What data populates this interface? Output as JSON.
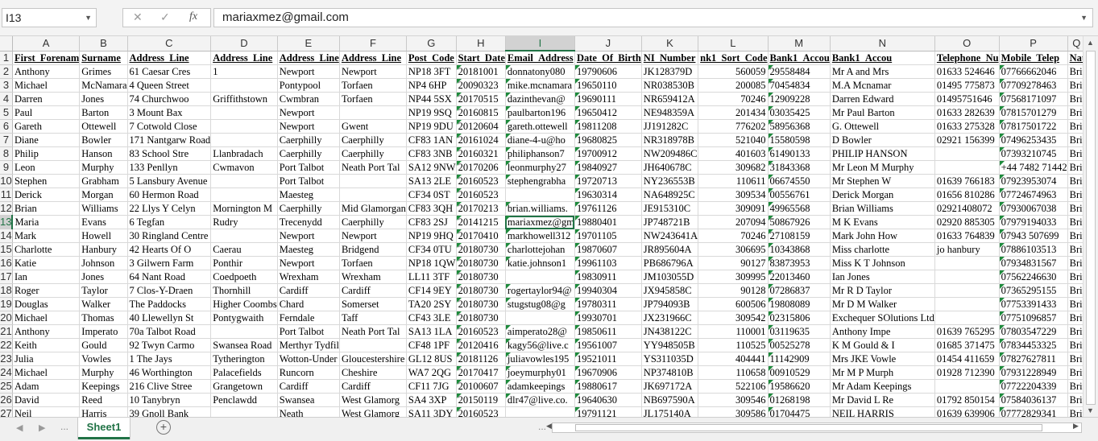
{
  "formula_bar": {
    "name_box": "I13",
    "cancel_icon": "✕",
    "confirm_icon": "✓",
    "fx_label": "fx",
    "value": "mariaxmez@gmail.com"
  },
  "columns": [
    "A",
    "B",
    "C",
    "D",
    "E",
    "F",
    "G",
    "H",
    "I",
    "J",
    "K",
    "L",
    "M",
    "N",
    "O",
    "P",
    "Q"
  ],
  "selected_column": "I",
  "selected_row": 13,
  "header_row": [
    "First_Forenam",
    "Surname",
    "Address_Line",
    "Address_Line",
    "Address_Line",
    "Address_Line",
    "Post_Code",
    "Start_Date",
    "Email_Address",
    "Date_Of_Birth",
    "NI_Number",
    "nk1_Sort_Code",
    "Bank1_Accou",
    "Bank1_Accou",
    "Telephone_Nu",
    "Mobile_Telep",
    "Nat"
  ],
  "rows": [
    [
      "Anthony",
      "Grimes",
      "61 Caesar Cres",
      "1",
      "Newport",
      "Newport",
      "NP18 3FT",
      "20181001",
      "donnatony080",
      "19790606",
      "JK128379D",
      "560059",
      "29558484",
      "Mr A and Mrs",
      "01633 524646",
      "07766662046",
      "Brit"
    ],
    [
      "Michael",
      "McNamara",
      "4 Queen Street",
      "",
      "Pontypool",
      "Torfaen",
      "NP4 6HP",
      "20090323",
      "mike.mcnamara",
      "19650110",
      "NR038530B",
      "200085",
      "70454834",
      "M.A Mcnamar",
      "01495 775873",
      "07709278463",
      "Brit"
    ],
    [
      "Darren",
      "Jones",
      "74 Churchwoo",
      "Griffithstown",
      "Cwmbran",
      "Torfaen",
      "NP44 5SX",
      "20170515",
      "dazinthevan@",
      "19690111",
      "NR659412A",
      "70246",
      "12909228",
      "Darren Edward",
      "01495751646",
      "07568171097",
      "Brit"
    ],
    [
      "Paul",
      "Barton",
      "3 Mount Bax",
      "",
      "Newport",
      "",
      "NP19 9SQ",
      "20160815",
      "paulbarton196",
      "19650412",
      "NE948359A",
      "201434",
      "03035425",
      "Mr Paul Barton",
      "01633 282639",
      "07815701279",
      "Brit"
    ],
    [
      "Gareth",
      "Ottewell",
      "7 Cotwold Close",
      "",
      "Newport",
      "Gwent",
      "NP19 9DU",
      "20120604",
      "gareth.ottewell",
      "19811208",
      "JJ191282C",
      "776202",
      "58956368",
      "G. Ottewell",
      "01633 275328",
      "07817501722",
      "Brit"
    ],
    [
      "Diane",
      "Bowler",
      "171 Nantgarw Road",
      "",
      "Caerphilly",
      "Caerphilly",
      "CF83 1AN",
      "20161024",
      "diane-4-u@ho",
      "19680825",
      "NR318978B",
      "521040",
      "15580598",
      "D Bowler",
      "02921 156399",
      "07496253435",
      "Brit"
    ],
    [
      "Philip",
      "Hanson",
      "83 School Stre",
      "Llanbradach",
      "Caerphilly",
      "Caerphilly",
      "CF83 3NB",
      "20160321",
      "philiphanson7",
      "19700912",
      "NW209486C",
      "401603",
      "61490133",
      "PHILIP HANSON",
      "",
      "07393210745",
      "Brit"
    ],
    [
      "Leon",
      "Murphy",
      "133 Penllyn",
      "Cwmavon",
      "Port Talbot",
      "Neath Port Tal",
      "SA12 9NW",
      "20170206",
      "leonmurphy27",
      "19840927",
      "JH640678C",
      "309682",
      "31843368",
      "Mr Leon M Murphy",
      "",
      "+44 7482 71442",
      "Brit"
    ],
    [
      "Stephen",
      "Grabham",
      "5 Lansbury Avenue",
      "",
      "Port Talbot",
      "",
      "SA13 2LE",
      "20160523",
      "stephengrabha",
      "19720713",
      "NY236553B",
      "110611",
      "06674550",
      "Mr Stephen W",
      "01639 766183",
      "07923953074",
      "Brit"
    ],
    [
      "Derick",
      "Morgan",
      "60 Hermon Road",
      "",
      "Maesteg",
      "",
      "CF34 0ST",
      "20160523",
      "",
      "19630314",
      "NA648925C",
      "309534",
      "00556761",
      "Derick Morgan",
      "01656 810286",
      "07724674963",
      "Brit"
    ],
    [
      "Brian",
      "Williams",
      "22 Llys Y Celyn",
      "Mornington M",
      "Caerphilly",
      "Mid Glamorgan",
      "CF83 3QH",
      "20170213",
      "brian.williams.",
      "19761126",
      "JE915310C",
      "309091",
      "49965568",
      "Brian Williams",
      "02921408072",
      "07930067038",
      "Brit"
    ],
    [
      "Maria",
      "Evans",
      "6 Tegfan",
      "Rudry",
      "Trecenydd",
      "Caerphilly",
      "CF83 2SJ",
      "20141215",
      "mariaxmez@gm",
      "19880401",
      "JP748721B",
      "207094",
      "50867926",
      "M K Evans",
      "02920 885305",
      "07979194033",
      "Brit"
    ],
    [
      "Mark",
      "Howell",
      "30 Ringland Centre",
      "",
      "Newport",
      "Newport",
      "NP19 9HQ",
      "20170410",
      "markhowell312",
      "19701105",
      "NW243641A",
      "70246",
      "27108159",
      "Mark John How",
      "01633 764839",
      "07943 507699",
      "Brit"
    ],
    [
      "Charlotte",
      "Hanbury",
      "42 Hearts Of O",
      "Caerau",
      "Maesteg",
      "Bridgend",
      "CF34 0TU",
      "20180730",
      "charlottejohan",
      "19870607",
      "JR895604A",
      "306695",
      "10343868",
      "Miss charlotte",
      "jo hanbury",
      "07886103513",
      "Brit"
    ],
    [
      "Katie",
      "Johnson",
      "3 Gilwern Farm",
      "Ponthir",
      "Newport",
      "Torfaen",
      "NP18 1QW",
      "20180730",
      "katie.johnson1",
      "19961103",
      "PB686796A",
      "90127",
      "83873953",
      "Miss K T Johnson",
      "",
      "07934831567",
      "Brit"
    ],
    [
      "Ian",
      "Jones",
      "64 Nant Road",
      "Coedpoeth",
      "Wrexham",
      "Wrexham",
      "LL11 3TF",
      "20180730",
      "",
      "19830911",
      "JM103055D",
      "309995",
      "22013460",
      "Ian Jones",
      "",
      "07562246630",
      "Brit"
    ],
    [
      "Roger",
      "Taylor",
      "7 Clos-Y-Draen",
      "Thornhill",
      "Cardiff",
      "Cardiff",
      "CF14 9EY",
      "20180730",
      "rogertaylor94@",
      "19940304",
      "JX945858C",
      "90128",
      "07286837",
      "Mr R D Taylor",
      "",
      "07365295155",
      "Brit"
    ],
    [
      "Douglas",
      "Walker",
      "The Paddocks",
      "Higher Coombs",
      "Chard",
      "Somerset",
      "TA20 2SY",
      "20180730",
      "stugstug08@g",
      "19780311",
      "JP794093B",
      "600506",
      "19808089",
      "Mr D M Walker",
      "",
      "07753391433",
      "Brit"
    ],
    [
      "Michael",
      "Thomas",
      "40 Llewellyn St",
      "Pontygwaith",
      "Ferndale",
      "Taff",
      "CF43 3LE",
      "20180730",
      "",
      "19930701",
      "JX231966C",
      "309542",
      "02315806",
      "Exchequer SOlutions Ltd",
      "",
      "07751096857",
      "Brit"
    ],
    [
      "Anthony",
      "Imperato",
      "70a Talbot Road",
      "",
      "Port Talbot",
      "Neath Port Tal",
      "SA13 1LA",
      "20160523",
      "aimperato28@",
      "19850611",
      "JN438122C",
      "110001",
      "03119635",
      "Anthony Impe",
      "01639 765295",
      "07803547229",
      "Brit"
    ],
    [
      "Keith",
      "Gould",
      "92 Twyn Carmo",
      "Swansea Road",
      "Merthyr Tydfil",
      "",
      "CF48 1PF",
      "20120416",
      "kagy56@live.c",
      "19561007",
      "YY948505B",
      "110525",
      "00525278",
      "K M Gould & I",
      "01685 371475",
      "07834453325",
      "Brit"
    ],
    [
      "Julia",
      "Vowles",
      "1 The Jays",
      "Tytherington",
      "Wotton-Under",
      "Gloucestershire",
      "GL12 8US",
      "20181126",
      "juliavowles195",
      "19521011",
      "YS311035D",
      "404441",
      "11142909",
      "Mrs JKE Vowle",
      "01454 411659",
      "07827627811",
      "Brit"
    ],
    [
      "Michael",
      "Murphy",
      "46 Worthington",
      "Palacefields",
      "Runcorn",
      "Cheshire",
      "WA7 2QG",
      "20170417",
      "joeymurphy01",
      "19670906",
      "NP374810B",
      "110658",
      "00910529",
      "Mr M P Murph",
      "01928 712390",
      "07931228949",
      "Brit"
    ],
    [
      "Adam",
      "Keepings",
      "216 Clive Stree",
      "Grangetown",
      "Cardiff",
      "Cardiff",
      "CF11 7JG",
      "20100607",
      "adamkeepings",
      "19880617",
      "JK697172A",
      "522106",
      "19586620",
      "Mr Adam Keepings",
      "",
      "07722204339",
      "Brit"
    ],
    [
      "David",
      "Reed",
      "10 Tanybryn",
      "Penclawdd",
      "Swansea",
      "West Glamorg",
      "SA4 3XP",
      "20150119",
      "dlr47@live.co.",
      "19640630",
      "NB697590A",
      "309546",
      "01268198",
      "Mr David L Re",
      "01792 850154",
      "07584036137",
      "Brit"
    ],
    [
      "Neil",
      "Harris",
      "39 Gnoll Bank",
      "",
      "Neath",
      "West Glamorg",
      "SA11 3DY",
      "20160523",
      "",
      "19791121",
      "JL175140A",
      "309586",
      "01704475",
      "NEIL HARRIS",
      "01639 639906",
      "07772829341",
      "Brit"
    ]
  ],
  "sheet_tabs": [
    "Sheet1"
  ],
  "tab_add_label": "+",
  "tab_dots": "..."
}
